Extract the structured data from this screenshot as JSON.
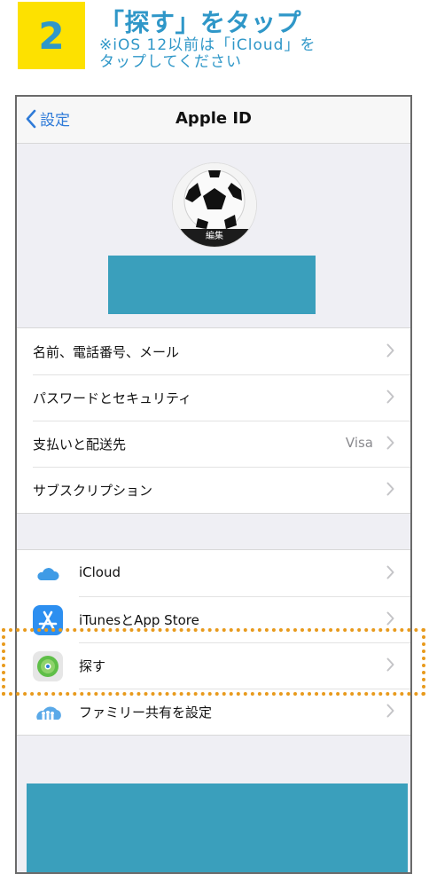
{
  "step": {
    "number": "2",
    "title": "「探す」をタップ",
    "note_line1": "※iOS 12以前は「iCloud」を",
    "note_line2": "タップしてください"
  },
  "navbar": {
    "back_label": "設定",
    "title": "Apple ID"
  },
  "profile": {
    "edit_label": "編集"
  },
  "account_rows": [
    {
      "label": "名前、電話番号、メール",
      "value": ""
    },
    {
      "label": "パスワードとセキュリティ",
      "value": ""
    },
    {
      "label": "支払いと配送先",
      "value": "Visa"
    },
    {
      "label": "サブスクリプション",
      "value": ""
    }
  ],
  "service_rows": [
    {
      "label": "iCloud",
      "icon": "icloud-icon"
    },
    {
      "label": "iTunesとApp Store",
      "icon": "app-store-icon"
    },
    {
      "label": "探す",
      "icon": "find-my-icon"
    },
    {
      "label": "ファミリー共有を設定",
      "icon": "family-sharing-icon"
    }
  ],
  "colors": {
    "accent": "#2f97c8",
    "badge": "#fde100",
    "highlight": "#e89a1c",
    "redaction": "#3a9fbc"
  }
}
